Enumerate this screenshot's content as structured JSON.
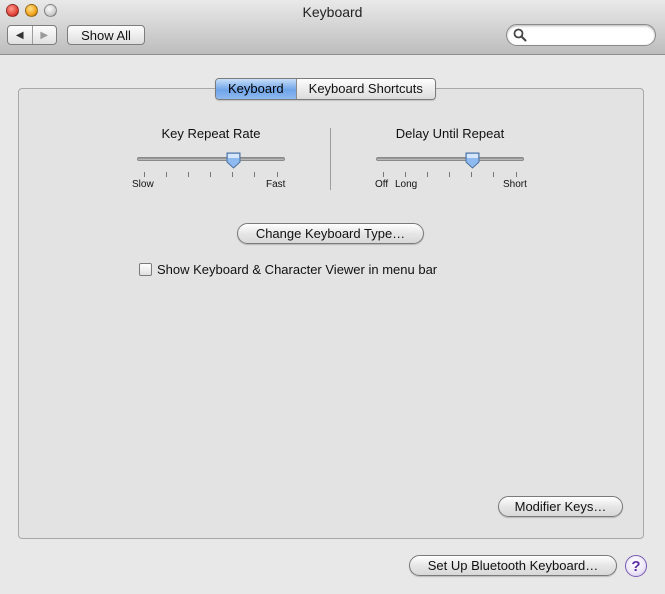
{
  "window": {
    "title": "Keyboard"
  },
  "toolbar": {
    "back_icon": "back-arrow-icon",
    "forward_icon": "forward-arrow-icon",
    "show_all_label": "Show All",
    "search": {
      "value": "",
      "placeholder": ""
    }
  },
  "tabs": [
    {
      "label": "Keyboard",
      "selected": true
    },
    {
      "label": "Keyboard Shortcuts",
      "selected": false
    }
  ],
  "key_repeat": {
    "title": "Key Repeat Rate",
    "min_label": "Slow",
    "max_label": "Fast",
    "value_fraction": 0.65
  },
  "delay_repeat": {
    "title": "Delay Until Repeat",
    "off_label": "Off",
    "min_label": "Long",
    "max_label": "Short",
    "value_fraction": 0.65
  },
  "change_keyboard_type_label": "Change Keyboard Type…",
  "viewer_checkbox": {
    "label": "Show Keyboard & Character Viewer in menu bar",
    "checked": false
  },
  "modifier_keys_label": "Modifier Keys…",
  "bluetooth_label": "Set Up Bluetooth Keyboard…",
  "help_label": "?",
  "colors": {
    "accent": "#6ea4e8",
    "help": "#5a2ea3"
  }
}
